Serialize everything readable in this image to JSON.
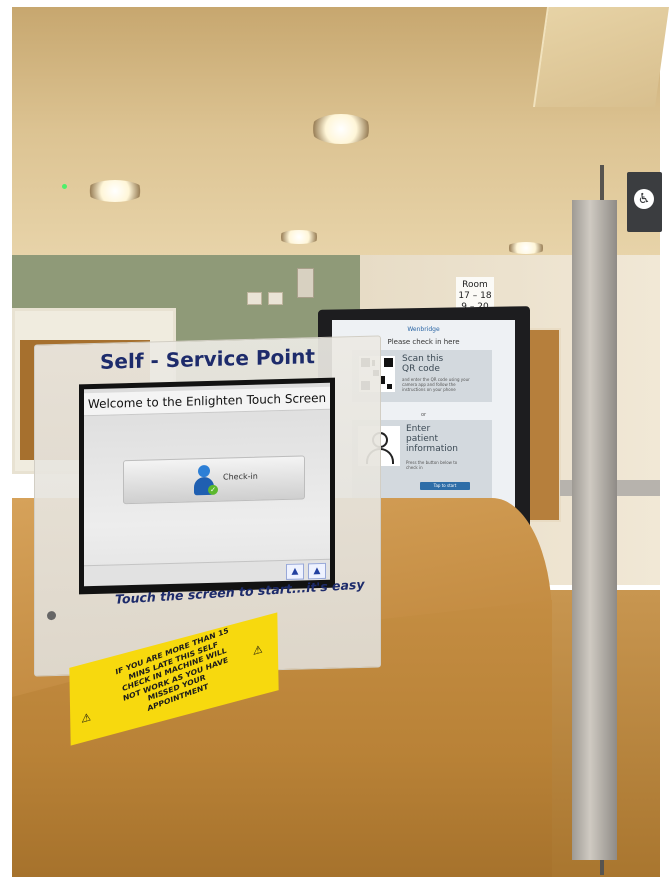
{
  "kiosk_left": {
    "header": "Self - Service Point",
    "screen_title": "Welcome to the Enlighten Touch Screen",
    "checkin_label": "Check-in",
    "footer": "Touch the screen to start...it's easy"
  },
  "kiosk_right": {
    "logo_text": "Wenbridge",
    "heading": "Please check in here",
    "qr_title_line1": "Scan this",
    "qr_title_line2": "QR code",
    "qr_small_text": "and enter the QR code using your camera app and follow the instructions on your phone",
    "or_text": "or",
    "patient_title_line1": "Enter",
    "patient_title_line2": "patient",
    "patient_title_line3": "information",
    "patient_small_text": "Press the button below to check in",
    "button_label": "Tap to start"
  },
  "yellow_sign": {
    "line1": "IF YOU ARE MORE THAN 15",
    "line2": "MINS LATE THIS SELF",
    "line3": "CHECK IN MACHINE WILL",
    "line4": "NOT WORK AS YOU HAVE",
    "line5": "MISSED YOUR",
    "line6": "APPOINTMENT"
  },
  "room_sign": {
    "title": "Room",
    "line1": "17 – 18",
    "line2": "9 – 20"
  },
  "icons": {
    "wheelchair": "♿",
    "warning": "⚠"
  },
  "colors": {
    "brand_navy": "#1d2b6b",
    "sign_yellow": "#f7d90e",
    "accent_blue": "#2e6ea8"
  }
}
